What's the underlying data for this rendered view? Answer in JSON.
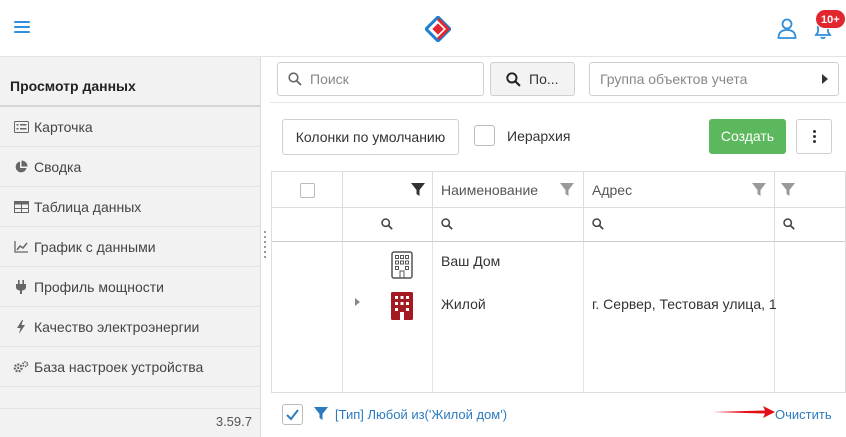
{
  "header": {
    "menu_icon": "hamburger-icon",
    "logo_icon": "diamond-logo-icon",
    "user_icon": "user-icon",
    "bell_icon": "bell-icon",
    "notifications_badge": "10+",
    "accent_color": "#2f8fdc",
    "badge_color": "#e2262e"
  },
  "sidebar": {
    "title": "Просмотр данных",
    "items": [
      {
        "label": "Карточка",
        "icon": "list-card-icon"
      },
      {
        "label": "Сводка",
        "icon": "pie-chart-icon"
      },
      {
        "label": "Таблица данных",
        "icon": "table-icon"
      },
      {
        "label": "График с данными",
        "icon": "line-chart-icon"
      },
      {
        "label": "Профиль мощности",
        "icon": "plug-icon"
      },
      {
        "label": "Качество электроэнергии",
        "icon": "bolt-icon"
      },
      {
        "label": "База настроек устройства",
        "icon": "gears-icon"
      }
    ],
    "version": "3.59.7"
  },
  "toolbar": {
    "search_placeholder": "Поиск",
    "search_button_label": "По...",
    "group_placeholder": "Группа объектов учета",
    "default_columns_label": "Колонки по умолчанию",
    "hierarchy_label": "Иерархия",
    "create_label": "Создать",
    "create_color": "#5cb85c"
  },
  "grid": {
    "columns": [
      "Наименование",
      "Адрес"
    ],
    "rows": [
      {
        "name": "Ваш Дом",
        "address": "",
        "icon": "building-outline-icon"
      },
      {
        "name": "Жилой",
        "address": "г. Сервер, Тестовая улица, 1",
        "icon": "building-filled-icon",
        "icon_color": "#a31a22"
      }
    ]
  },
  "footer": {
    "filter_text": "[Тип] Любой из('Жилой дом')",
    "clear_label": "Очистить",
    "link_color": "#2c7bbf",
    "arrow_color": "#e2101a"
  }
}
